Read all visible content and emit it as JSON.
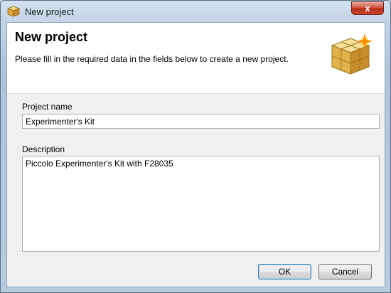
{
  "window": {
    "title": "New project",
    "close_label": "x"
  },
  "header": {
    "title": "New project",
    "subtitle": "Please fill in the required data in the fields below to create a new project."
  },
  "form": {
    "project_name_label": "Project name",
    "project_name_value": "Experimenter's Kit",
    "description_label": "Description",
    "description_value": "Piccolo Experimenter's Kit with F28035"
  },
  "buttons": {
    "ok": "OK",
    "cancel": "Cancel"
  },
  "colors": {
    "cube_top": "#f3d98a",
    "cube_side": "#d9a93a",
    "sparkle": "#ff8a00"
  }
}
